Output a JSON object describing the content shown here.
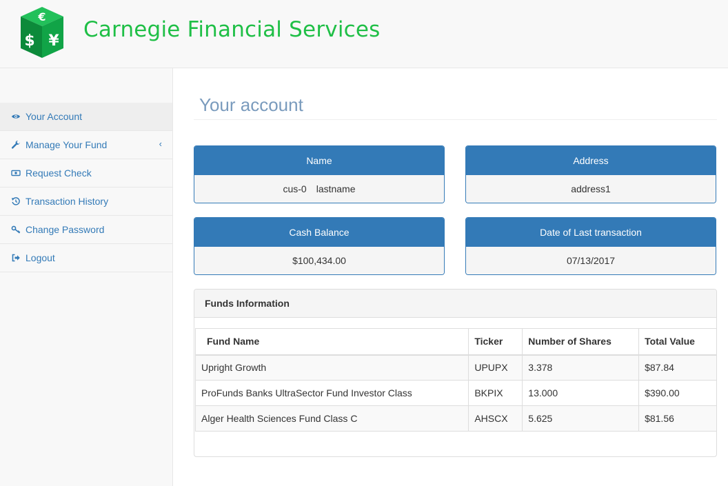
{
  "brand": {
    "name": "Carnegie Financial Services",
    "color": "#1fbf46"
  },
  "sidebar": {
    "items": [
      {
        "label": "Your Account",
        "icon": "eye-icon",
        "active": true
      },
      {
        "label": "Manage Your Fund",
        "icon": "wrench-icon",
        "has_submenu": true
      },
      {
        "label": "Request Check",
        "icon": "money-icon"
      },
      {
        "label": "Transaction History",
        "icon": "history-icon"
      },
      {
        "label": "Change Password",
        "icon": "key-icon"
      },
      {
        "label": "Logout",
        "icon": "logout-icon"
      }
    ],
    "submenu_caret": "‹"
  },
  "main": {
    "title": "Your account",
    "panels": {
      "name": {
        "heading": "Name",
        "value": "cus-0 lastname"
      },
      "address": {
        "heading": "Address",
        "value": "address1"
      },
      "cash": {
        "heading": "Cash Balance",
        "value": "$100,434.00"
      },
      "last_tx": {
        "heading": "Date of Last transaction",
        "value": "07/13/2017"
      }
    },
    "funds": {
      "heading": "Funds Information",
      "columns": [
        "Fund Name",
        "Ticker",
        "Number of Shares",
        "Total Value"
      ],
      "rows": [
        [
          "Upright Growth",
          "UPUPX",
          "3.378",
          "$87.84"
        ],
        [
          "ProFunds Banks UltraSector Fund Investor Class",
          "BKPIX",
          "13.000",
          "$390.00"
        ],
        [
          "Alger Health Sciences Fund Class C",
          "AHSCX",
          "5.625",
          "$81.56"
        ]
      ]
    }
  },
  "colors": {
    "panel_primary": "#337ab7",
    "link": "#337ab7",
    "title": "#7a9bbd"
  }
}
